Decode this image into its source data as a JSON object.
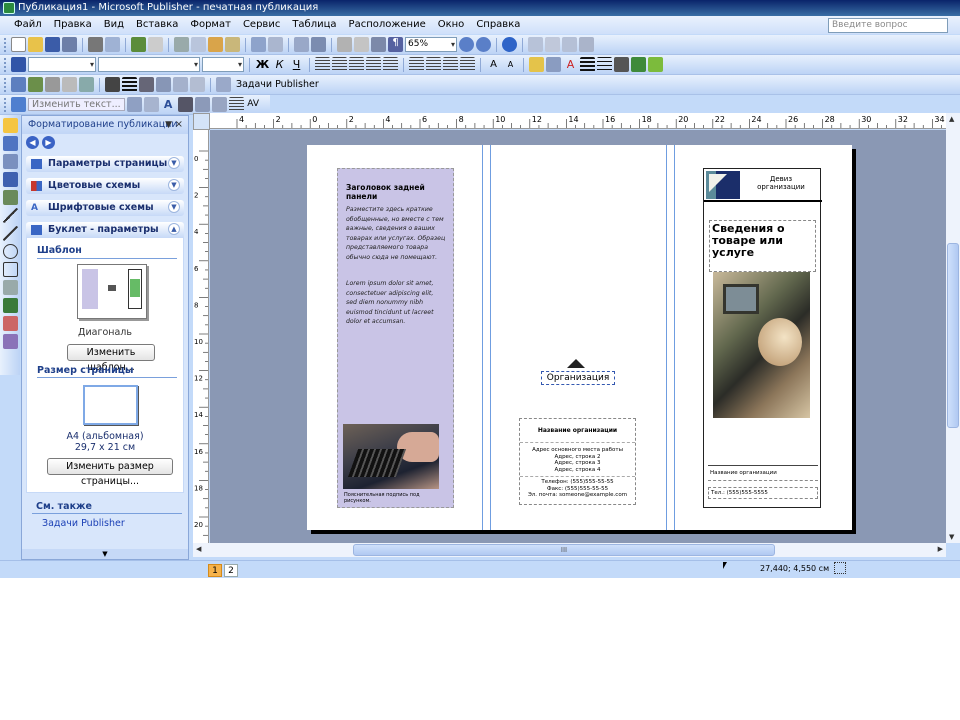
{
  "window": {
    "title": "Публикация1 - Microsoft Publisher - печатная публикация",
    "buttons": [
      "_",
      "□",
      "×"
    ]
  },
  "menu": {
    "items": [
      "Файл",
      "Правка",
      "Вид",
      "Вставка",
      "Формат",
      "Сервис",
      "Таблица",
      "Расположение",
      "Окно",
      "Справка"
    ],
    "help_placeholder": "Введите вопрос"
  },
  "toolbar_standard": {
    "zoom": "65%"
  },
  "toolbar_publisher": {
    "tasks_label": "Задачи Publisher",
    "change_text": "Изменить текст..."
  },
  "taskpane": {
    "title": "Форматирование публикации",
    "sections": [
      {
        "label": "Параметры страницы",
        "color": "#3a66c4"
      },
      {
        "label": "Цветовые схемы",
        "color": "#c8372d"
      },
      {
        "label": "Шрифтовые схемы",
        "color": "#3a66c4"
      },
      {
        "label": "Буклет - параметры",
        "color": "#3a66c4"
      }
    ],
    "template_heading": "Шаблон",
    "template_name": "Диагональ",
    "change_template": "Изменить шаблон...",
    "page_size_heading": "Размер страницы",
    "page_size_name": "A4 (альбомная)",
    "page_size_dims": "29,7 x 21 см",
    "change_page_size": "Изменить размер страницы...",
    "see_also": "См. также",
    "link": "Задачи Publisher"
  },
  "ruler": {
    "h_labels": [
      "4",
      "2",
      "0",
      "2",
      "4",
      "6",
      "8",
      "10",
      "12",
      "14",
      "16",
      "18",
      "20",
      "22",
      "24",
      "26",
      "28",
      "30",
      "32",
      "34"
    ],
    "v_labels": [
      "0",
      "2",
      "4",
      "6",
      "8",
      "10",
      "12",
      "14",
      "16",
      "18",
      "20"
    ]
  },
  "document": {
    "back_panel_title": "Заголовок задней панели",
    "back_panel_text1": "Разместите здесь краткие обобщенные, но вместе с тем важные, сведения о ваших товарах или услугах. Образец представляемого товара обычно сюда не помещают.",
    "back_panel_text2": "Lorem ipsum dolor sit amet, consectetuer adipiscing elit, sed diem nonummy nibh euismod tincidunt ut lacreet dolor et accumsan.",
    "photo_caption": "Пояснительная подпись под рисунком.",
    "org_label": "Организация",
    "org_name": "Название организации",
    "address": [
      "Адрес основного места работы",
      "Адрес, строка 2",
      "Адрес, строка 3",
      "Адрес, строка 4"
    ],
    "phone": "Телефон: (555)555-55-55",
    "fax": "Факс: (555)555-55-55",
    "email": "Эл. почта: someone@example.com",
    "motto": "Девиз организации",
    "headline": "Сведения о товаре или услуге",
    "front_org_name": "Название организации",
    "front_tel": "Тел.: (555)555-5555"
  },
  "scrollbar": {
    "grip": "III"
  },
  "status": {
    "pages": [
      "1",
      "2"
    ],
    "coords": "27,440; 4,550 см"
  }
}
